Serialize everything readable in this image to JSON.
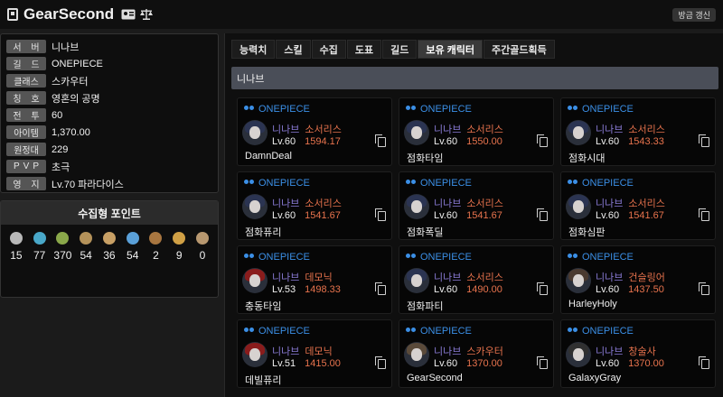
{
  "app": {
    "title": "GearSecond",
    "refresh_label": "방금 갱신"
  },
  "profile": {
    "rows": [
      {
        "label": "서 버",
        "value": "니나브"
      },
      {
        "label": "길 드",
        "value": "ONEPIECE"
      },
      {
        "label": "클래스",
        "value": "스카우터"
      },
      {
        "label": "칭 호",
        "value": "영혼의 공명"
      },
      {
        "label": "전 투",
        "value": "60"
      },
      {
        "label": "아이템",
        "value": "1,370.00"
      },
      {
        "label": "원정대",
        "value": "229"
      },
      {
        "label": "PVP",
        "value": "초극"
      },
      {
        "label": "영 지",
        "value": "Lv.70 파라다이스"
      }
    ]
  },
  "collect": {
    "title": "수집형 포인트",
    "items": [
      {
        "icon": "island-heart-icon",
        "count": "15",
        "color": "#b8b8b8"
      },
      {
        "icon": "orb-icon",
        "count": "77",
        "color": "#49a8c9"
      },
      {
        "icon": "seed-icon",
        "count": "370",
        "color": "#8aa84a"
      },
      {
        "icon": "art-icon",
        "count": "54",
        "color": "#b4925a"
      },
      {
        "icon": "voyage-icon",
        "count": "36",
        "color": "#c8a065"
      },
      {
        "icon": "leaf-icon",
        "count": "54",
        "color": "#5aa0d8"
      },
      {
        "icon": "mask-icon",
        "count": "2",
        "color": "#a87640"
      },
      {
        "icon": "star-icon",
        "count": "9",
        "color": "#d0a045"
      },
      {
        "icon": "coin-icon",
        "count": "0",
        "color": "#b89870"
      }
    ]
  },
  "tabs": [
    {
      "label": "능력치",
      "active": false
    },
    {
      "label": "스킬",
      "active": false
    },
    {
      "label": "수집",
      "active": false
    },
    {
      "label": "도표",
      "active": false
    },
    {
      "label": "길드",
      "active": false
    },
    {
      "label": "보유 캐릭터",
      "active": true
    },
    {
      "label": "주간골드획득",
      "active": false
    }
  ],
  "characters": {
    "server_header": "니나브",
    "list": [
      {
        "guild": "ONEPIECE",
        "server": "니나브",
        "class": "소서리스",
        "level": "Lv.60",
        "item_level": "1594.17",
        "name": "DamnDeal",
        "hair": "#2b3452"
      },
      {
        "guild": "ONEPIECE",
        "server": "니나브",
        "class": "소서리스",
        "level": "Lv.60",
        "item_level": "1550.00",
        "name": "점화타임",
        "hair": "#2b3452"
      },
      {
        "guild": "ONEPIECE",
        "server": "니나브",
        "class": "소서리스",
        "level": "Lv.60",
        "item_level": "1543.33",
        "name": "점화시대",
        "hair": "#2b3452"
      },
      {
        "guild": "ONEPIECE",
        "server": "니나브",
        "class": "소서리스",
        "level": "Lv.60",
        "item_level": "1541.67",
        "name": "점화퓨리",
        "hair": "#2b3452"
      },
      {
        "guild": "ONEPIECE",
        "server": "니나브",
        "class": "소서리스",
        "level": "Lv.60",
        "item_level": "1541.67",
        "name": "점화폭딜",
        "hair": "#2b3452"
      },
      {
        "guild": "ONEPIECE",
        "server": "니나브",
        "class": "소서리스",
        "level": "Lv.60",
        "item_level": "1541.67",
        "name": "점화심판",
        "hair": "#2b3452"
      },
      {
        "guild": "ONEPIECE",
        "server": "니나브",
        "class": "데모닉",
        "level": "Lv.53",
        "item_level": "1498.33",
        "name": "충동타임",
        "hair": "#8a1c1c"
      },
      {
        "guild": "ONEPIECE",
        "server": "니나브",
        "class": "소서리스",
        "level": "Lv.60",
        "item_level": "1490.00",
        "name": "점화파티",
        "hair": "#2b3452"
      },
      {
        "guild": "ONEPIECE",
        "server": "니나브",
        "class": "건슬링어",
        "level": "Lv.60",
        "item_level": "1437.50",
        "name": "HarleyHoly",
        "hair": "#4a3a30"
      },
      {
        "guild": "ONEPIECE",
        "server": "니나브",
        "class": "데모닉",
        "level": "Lv.51",
        "item_level": "1415.00",
        "name": "데빌퓨리",
        "hair": "#8a1c1c"
      },
      {
        "guild": "ONEPIECE",
        "server": "니나브",
        "class": "스카우터",
        "level": "Lv.60",
        "item_level": "1370.00",
        "name": "GearSecond",
        "hair": "#5a4a3a"
      },
      {
        "guild": "ONEPIECE",
        "server": "니나브",
        "class": "창술사",
        "level": "Lv.60",
        "item_level": "1370.00",
        "name": "GalaxyGray",
        "hair": "#303030"
      }
    ]
  }
}
